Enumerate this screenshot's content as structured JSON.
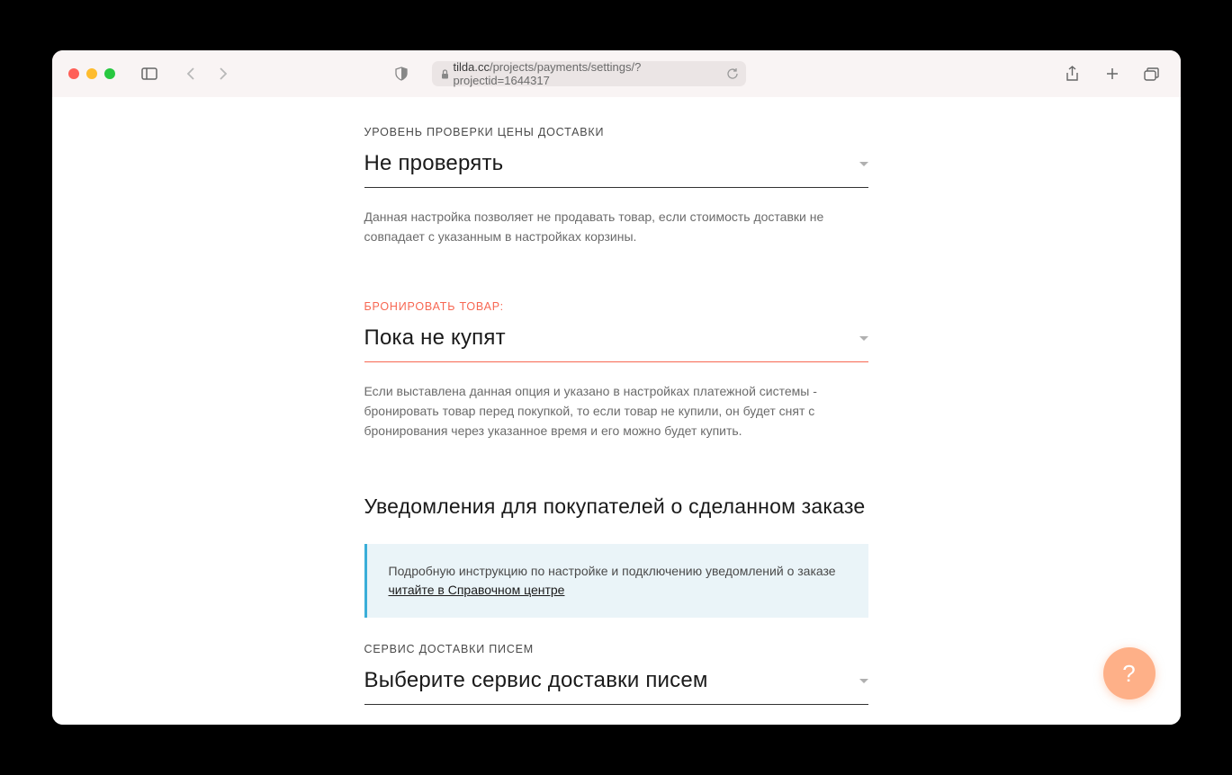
{
  "browser": {
    "url_domain": "tilda.cc",
    "url_path": "/projects/payments/settings/?projectid=1644317"
  },
  "settings": {
    "delivery_check": {
      "label": "УРОВЕНЬ ПРОВЕРКИ ЦЕНЫ ДОСТАВКИ",
      "value": "Не проверять",
      "description": "Данная настройка позволяет не продавать товар, если стоимость доставки не совпадает с указанным в настройках корзины."
    },
    "reserve_product": {
      "label": "БРОНИРОВАТЬ ТОВАР:",
      "value": "Пока не купят",
      "description": "Если выставлена данная опция и указано в настройках платежной системы - бронировать товар перед покупкой, то если товар не купили, он будет снят с бронирования через указанное время и его можно будет купить."
    },
    "notifications": {
      "heading": "Уведомления для покупателей о сделанном заказе",
      "info_text": "Подробную инструкцию по настройке и подключению уведомлений о заказе ",
      "info_link": "читайте в Справочном центре"
    },
    "mail_service": {
      "label": "СЕРВИС ДОСТАВКИ ПИСЕМ",
      "value": "Выберите сервис доставки писем"
    }
  },
  "help": {
    "symbol": "?"
  }
}
